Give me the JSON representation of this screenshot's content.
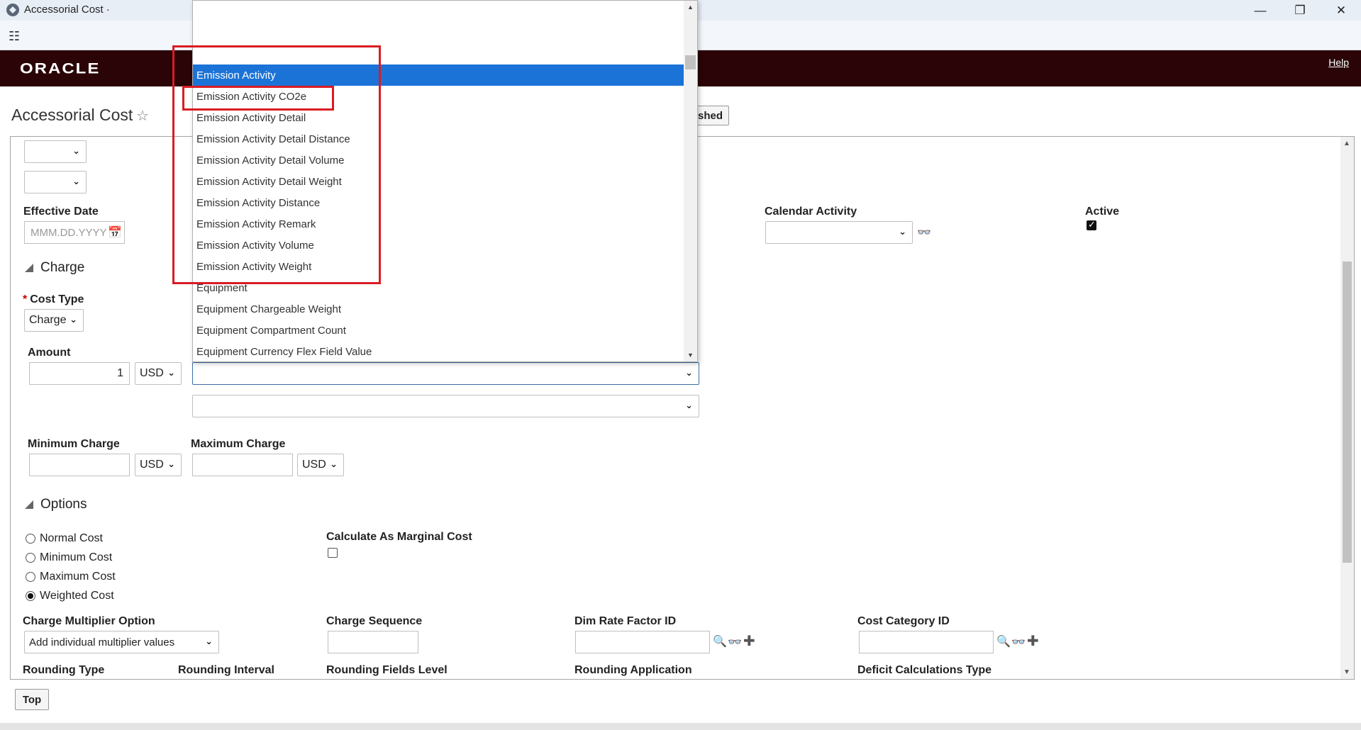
{
  "window": {
    "title": "Accessorial Cost ·",
    "minimize": "—",
    "restore": "❐",
    "close": "✕"
  },
  "header": {
    "logo": "ORACLE",
    "help": "Help"
  },
  "page": {
    "title": "Accessorial Cost",
    "finished_label": "shed",
    "top_label": "Top"
  },
  "form": {
    "effective_date": {
      "label": "Effective Date",
      "placeholder": "MMM.DD.YYYY"
    },
    "calendar_activity": {
      "label": "Calendar Activity"
    },
    "active": {
      "label": "Active",
      "checked": true
    },
    "charge_section": "Charge",
    "cost_type": {
      "label": "Cost Type",
      "value": "Charge"
    },
    "amount": {
      "label": "Amount",
      "value": "1",
      "currency": "USD"
    },
    "minimum_charge": {
      "label": "Minimum Charge",
      "currency": "USD"
    },
    "maximum_charge": {
      "label": "Maximum Charge",
      "currency": "USD"
    },
    "options_section": "Options",
    "radios": [
      "Normal Cost",
      "Minimum Cost",
      "Maximum Cost",
      "Weighted Cost"
    ],
    "radio_selected": "Weighted Cost",
    "calc_marginal": {
      "label": "Calculate As Marginal Cost"
    },
    "charge_multiplier": {
      "label": "Charge Multiplier Option",
      "value": "Add individual multiplier values"
    },
    "charge_sequence": {
      "label": "Charge Sequence"
    },
    "dim_rate_factor": {
      "label": "Dim Rate Factor ID"
    },
    "cost_category": {
      "label": "Cost Category ID"
    },
    "bottom_labels": [
      "Rounding Type",
      "Rounding Interval",
      "Rounding Fields Level",
      "Rounding Application",
      "Deficit Calculations Type"
    ]
  },
  "dropdown": {
    "items": [
      "Emission Activity",
      "Emission Activity CO2e",
      "Emission Activity Detail",
      "Emission Activity Detail Distance",
      "Emission Activity Detail Volume",
      "Emission Activity Detail Weight",
      "Emission Activity Distance",
      "Emission Activity Remark",
      "Emission Activity Volume",
      "Emission Activity Weight",
      "Equipment",
      "Equipment Chargeable Weight",
      "Equipment Compartment Count",
      "Equipment Currency Flex Field Value"
    ],
    "selected": "Emission Activity"
  },
  "colors": {
    "brand_bar": "#2a0406",
    "selection": "#1b73d8",
    "highlight_box": "#d91c24"
  }
}
